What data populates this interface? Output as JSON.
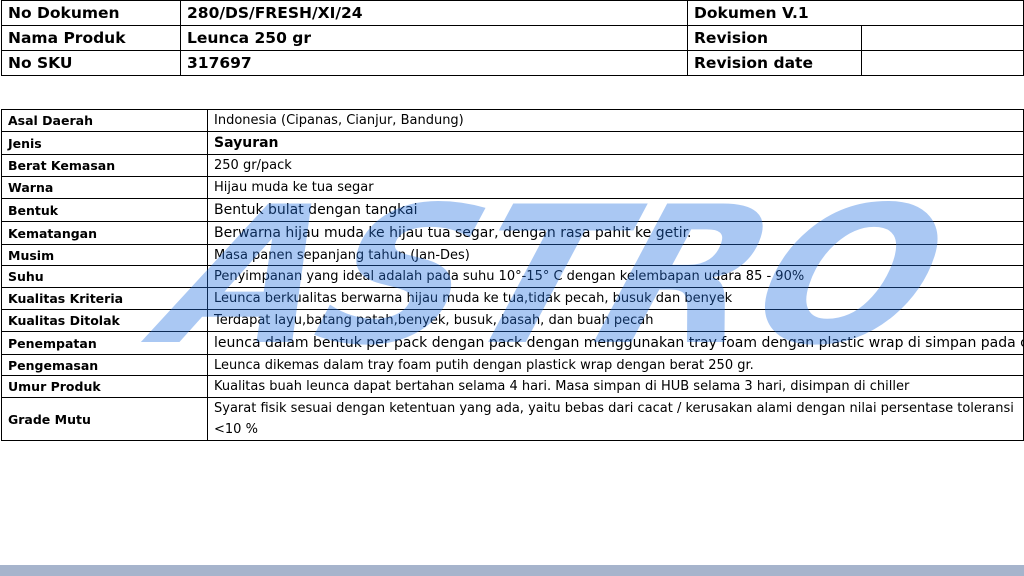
{
  "header": {
    "rows": [
      {
        "label": "No Dokumen",
        "value": "280/DS/FRESH/XI/24",
        "meta_label": "Dokumen V.1",
        "meta_value": ""
      },
      {
        "label": "Nama Produk",
        "value": "Leunca 250 gr",
        "meta_label": "Revision",
        "meta_value": ""
      },
      {
        "label": "No SKU",
        "value": "317697",
        "meta_label": "Revision date",
        "meta_value": ""
      }
    ]
  },
  "spec": {
    "rows": [
      {
        "label": "Asal Daerah",
        "value": "Indonesia (Cipanas, Cianjur, Bandung)"
      },
      {
        "label": "Jenis",
        "value": "Sayuran"
      },
      {
        "label": "Berat Kemasan",
        "value": "250 gr/pack"
      },
      {
        "label": "Warna",
        "value": "Hijau muda ke tua segar"
      },
      {
        "label": "Bentuk",
        "value": "Bentuk bulat dengan tangkai"
      },
      {
        "label": "Kematangan",
        "value": "Berwarna hijau muda ke hijau tua segar, dengan rasa pahit ke getir."
      },
      {
        "label": "Musim",
        "value": "Masa panen sepanjang tahun (Jan-Des)"
      },
      {
        "label": "Suhu",
        "value": "Penyimpanan yang ideal adalah pada suhu 10°-15° C dengan kelembapan udara 85 - 90%"
      },
      {
        "label": "Kualitas Kriteria",
        "value": "Leunca berkualitas berwarna hijau muda ke tua,tidak pecah, busuk  dan benyek"
      },
      {
        "label": "Kualitas Ditolak",
        "value": "Terdapat layu,batang patah,benyek, busuk, basah, dan buah pecah"
      },
      {
        "label": "Penempatan",
        "value": "leunca dalam bentuk per pack dengan pack dengan menggunakan tray foam dengan plastic wrap di simpan pada chiller"
      },
      {
        "label": "Pengemasan",
        "value": "Leunca dikemas dalam tray foam putih dengan plastick wrap dengan berat 250 gr."
      },
      {
        "label": "Umur Produk",
        "value": "Kualitas buah leunca dapat bertahan selama 4 hari. Masa simpan di HUB selama 3 hari, disimpan di chiller"
      },
      {
        "label": "Grade Mutu",
        "value": "Syarat fisik sesuai dengan ketentuan yang ada, yaitu bebas dari cacat / kerusakan alami dengan nilai persentase toleransi <10 %"
      }
    ]
  },
  "watermark": {
    "text": "ASTRO",
    "color": "#1f6fe0"
  },
  "colors": {
    "bottom_bar": "#a6b4cc"
  }
}
